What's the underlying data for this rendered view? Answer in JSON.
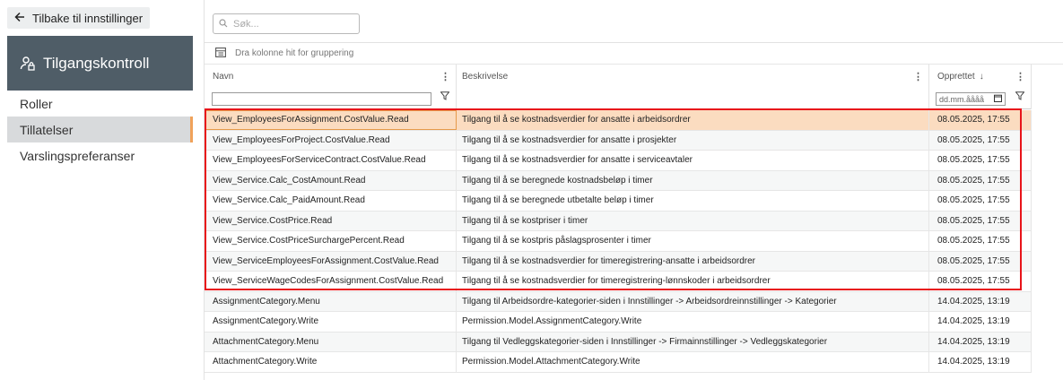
{
  "sidebar": {
    "back_label": "Tilbake til innstillinger",
    "panel_title": "Tilgangskontroll",
    "items": [
      {
        "label": "Roller",
        "active": false
      },
      {
        "label": "Tillatelser",
        "active": true
      },
      {
        "label": "Varslingspreferanser",
        "active": false
      }
    ]
  },
  "search": {
    "placeholder": "Søk..."
  },
  "grouping": {
    "hint": "Dra kolonne hit for gruppering"
  },
  "columns": {
    "name": "Navn",
    "description": "Beskrivelse",
    "created": "Opprettet",
    "sort_indicator": "↓"
  },
  "filters": {
    "date_placeholder": "dd.mm.åååå"
  },
  "rows": [
    {
      "name": "View_EmployeesForAssignment.CostValue.Read",
      "description": "Tilgang til å se kostnadsverdier for ansatte i arbeidsordrer",
      "created": "08.05.2025, 17:55",
      "selected": true
    },
    {
      "name": "View_EmployeesForProject.CostValue.Read",
      "description": "Tilgang til å se kostnadsverdier for ansatte i prosjekter",
      "created": "08.05.2025, 17:55"
    },
    {
      "name": "View_EmployeesForServiceContract.CostValue.Read",
      "description": "Tilgang til å se kostnadsverdier for ansatte i serviceavtaler",
      "created": "08.05.2025, 17:55"
    },
    {
      "name": "View_Service.Calc_CostAmount.Read",
      "description": "Tilgang til å se beregnede kostnadsbeløp i timer",
      "created": "08.05.2025, 17:55"
    },
    {
      "name": "View_Service.Calc_PaidAmount.Read",
      "description": "Tilgang til å se beregnede utbetalte beløp i timer",
      "created": "08.05.2025, 17:55"
    },
    {
      "name": "View_Service.CostPrice.Read",
      "description": "Tilgang til å se kostpriser i timer",
      "created": "08.05.2025, 17:55"
    },
    {
      "name": "View_Service.CostPriceSurchargePercent.Read",
      "description": "Tilgang til å se kostpris påslagsprosenter i timer",
      "created": "08.05.2025, 17:55"
    },
    {
      "name": "View_ServiceEmployeesForAssignment.CostValue.Read",
      "description": "Tilgang til å se kostnadsverdier for timeregistrering-ansatte i arbeidsordrer",
      "created": "08.05.2025, 17:55"
    },
    {
      "name": "View_ServiceWageCodesForAssignment.CostValue.Read",
      "description": "Tilgang til å se kostnadsverdier for timeregistrering-lønnskoder i arbeidsordrer",
      "created": "08.05.2025, 17:55"
    },
    {
      "name": "AssignmentCategory.Menu",
      "description": "Tilgang til Arbeidsordre-kategorier-siden i Innstillinger -> Arbeidsordreinnstillinger -> Kategorier",
      "created": "14.04.2025, 13:19"
    },
    {
      "name": "AssignmentCategory.Write",
      "description": "Permission.Model.AssignmentCategory.Write",
      "created": "14.04.2025, 13:19"
    },
    {
      "name": "AttachmentCategory.Menu",
      "description": "Tilgang til Vedleggskategorier-siden i Innstillinger -> Firmainnstillinger -> Vedleggskategorier",
      "created": "14.04.2025, 13:19"
    },
    {
      "name": "AttachmentCategory.Write",
      "description": "Permission.Model.AttachmentCategory.Write",
      "created": "14.04.2025, 13:19"
    }
  ],
  "colors": {
    "sidebar_header": "#4f5d67",
    "accent": "#f0a25a",
    "selected_row": "#fbdcc0",
    "highlight": "#e8141a"
  }
}
